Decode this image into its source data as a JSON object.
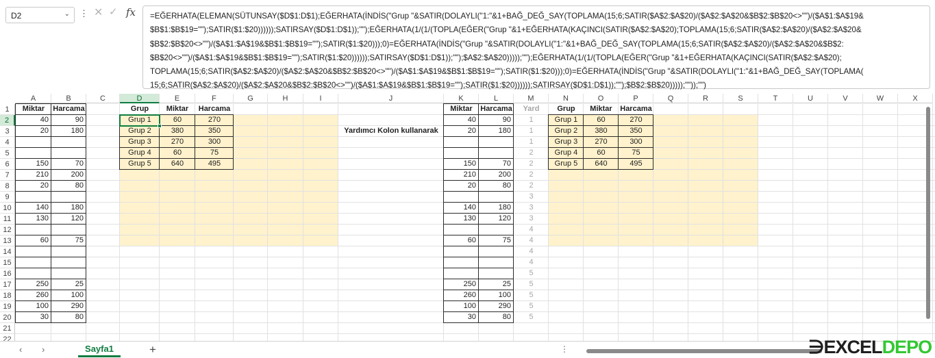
{
  "name_box": {
    "value": "D2",
    "arrow": "⌄"
  },
  "formula_bar": {
    "dots": "⋮",
    "cancel_icon": "✕",
    "enter_icon": "✓",
    "fx_label": "fx",
    "lines": [
      "=EĞERHATA(ELEMAN(SÜTUNSAY($D$1:D$1);EĞERHATA(İNDİS(\"Grup \"&SATIR(DOLAYLI(\"1:\"&1+BAĞ_DEĞ_SAY(TOPLAMA(15;6;SATIR($A$2:$A$20)/($A$2:$A$20&$B$2:$B$20<>\"\")/($A$1:$A$19&",
      "$B$1:$B$19=\"\");SATIR($1:$20))))));SATIRSAY($D$1:D$1));\"\");EĞERHATA(1/(1/(TOPLA(EĞER(\"Grup \"&1+EĞERHATA(KAÇINCI(SATIR($A$2:$A$20);TOPLAMA(15;6;SATIR($A$2:$A$20)/($A$2:$A$20&",
      "$B$2:$B$20<>\"\")/($A$1:$A$19&$B$1:$B$19=\"\");SATIR($1:$20)));0)=EĞERHATA(İNDİS(\"Grup \"&SATIR(DOLAYLI(\"1:\"&1+BAĞ_DEĞ_SAY(TOPLAMA(15;6;SATIR($A$2:$A$20)/($A$2:$A$20&$B$2:",
      "$B$20<>\"\")/($A$1:$A$19&$B$1:$B$19=\"\");SATIR($1:$20))))));SATIRSAY($D$1:D$1));\"\");$A$2:$A$20)))));\"\");EĞERHATA(1/(1/(TOPLA(EĞER(\"Grup \"&1+EĞERHATA(KAÇINCI(SATIR($A$2:$A$20);",
      "TOPLAMA(15;6;SATIR($A$2:$A$20)/($A$2:$A$20&$B$2:$B$20<>\"\")/($A$1:$A$19&$B$1:$B$19=\"\");SATIR($1:$20)));0)=EĞERHATA(İNDİS(\"Grup \"&SATIR(DOLAYLI(\"1:\"&1+BAĞ_DEĞ_SAY(TOPLAMA(",
      "15;6;SATIR($A$2:$A$20)/($A$2:$A$20&$B$2:$B$20<>\"\")/($A$1:$A$19&$B$1:$B$19=\"\");SATIR($1:$20))))));SATIRSAY($D$1:D$1));\"\");$B$2:$B$20)))));\"\"));\"\")"
    ]
  },
  "columns": [
    "A",
    "B",
    "C",
    "D",
    "E",
    "F",
    "G",
    "H",
    "I",
    "J",
    "K",
    "L",
    "M",
    "N",
    "O",
    "P",
    "Q",
    "R",
    "S",
    "T",
    "U",
    "V",
    "W",
    "X"
  ],
  "rows": [
    "1",
    "2",
    "3",
    "4",
    "5",
    "6",
    "7",
    "8",
    "9",
    "10",
    "11",
    "12",
    "13",
    "14",
    "15",
    "16",
    "17",
    "18",
    "19",
    "20",
    "21",
    "22"
  ],
  "source": {
    "headers": [
      "Miktar",
      "Harcama"
    ],
    "rows": [
      [
        "40",
        "90"
      ],
      [
        "20",
        "180"
      ],
      [
        "",
        ""
      ],
      [
        "",
        ""
      ],
      [
        "150",
        "70"
      ],
      [
        "210",
        "200"
      ],
      [
        "20",
        "80"
      ],
      [
        "",
        ""
      ],
      [
        "140",
        "180"
      ],
      [
        "130",
        "120"
      ],
      [
        "",
        ""
      ],
      [
        "60",
        "75"
      ],
      [
        "",
        ""
      ],
      [
        "",
        ""
      ],
      [
        "",
        ""
      ],
      [
        "250",
        "25"
      ],
      [
        "260",
        "100"
      ],
      [
        "100",
        "290"
      ],
      [
        "30",
        "80"
      ]
    ]
  },
  "result1": {
    "headers": [
      "Grup",
      "Miktar",
      "Harcama"
    ],
    "rows": [
      [
        "Grup 1",
        "60",
        "270"
      ],
      [
        "Grup 2",
        "380",
        "350"
      ],
      [
        "Grup 3",
        "270",
        "300"
      ],
      [
        "Grup 4",
        "60",
        "75"
      ],
      [
        "Grup 5",
        "640",
        "495"
      ]
    ]
  },
  "helper_title": "Yardımcı Kolon kullanarak",
  "source2": {
    "headers": [
      "Miktar",
      "Harcama",
      "Yard"
    ],
    "rows": [
      [
        "40",
        "90",
        "1"
      ],
      [
        "20",
        "180",
        "1"
      ],
      [
        "",
        "",
        "1"
      ],
      [
        "",
        "",
        "2"
      ],
      [
        "150",
        "70",
        "2"
      ],
      [
        "210",
        "200",
        "2"
      ],
      [
        "20",
        "80",
        "2"
      ],
      [
        "",
        "",
        "3"
      ],
      [
        "140",
        "180",
        "3"
      ],
      [
        "130",
        "120",
        "3"
      ],
      [
        "",
        "",
        "4"
      ],
      [
        "60",
        "75",
        "4"
      ],
      [
        "",
        "",
        "4"
      ],
      [
        "",
        "",
        "4"
      ],
      [
        "",
        "",
        "5"
      ],
      [
        "250",
        "25",
        "5"
      ],
      [
        "260",
        "100",
        "5"
      ],
      [
        "100",
        "290",
        "5"
      ],
      [
        "30",
        "80",
        "5"
      ]
    ]
  },
  "result2": {
    "headers": [
      "Grup",
      "Miktar",
      "Harcama"
    ],
    "rows": [
      [
        "Grup 1",
        "60",
        "270"
      ],
      [
        "Grup 2",
        "380",
        "350"
      ],
      [
        "Grup 3",
        "270",
        "300"
      ],
      [
        "Grup 4",
        "60",
        "75"
      ],
      [
        "Grup 5",
        "640",
        "495"
      ]
    ]
  },
  "sheet_tabs": {
    "prev": "‹",
    "next": "›",
    "active": "Sayfa1",
    "add": "+",
    "more": "⋮"
  },
  "logo": {
    "part1": "EXCEL",
    "part2": "DEPO",
    "prefix": "∋"
  },
  "colors": {
    "accent": "#107c41",
    "highlight": "#fff2cc",
    "header_selected": "#d3ead9"
  }
}
